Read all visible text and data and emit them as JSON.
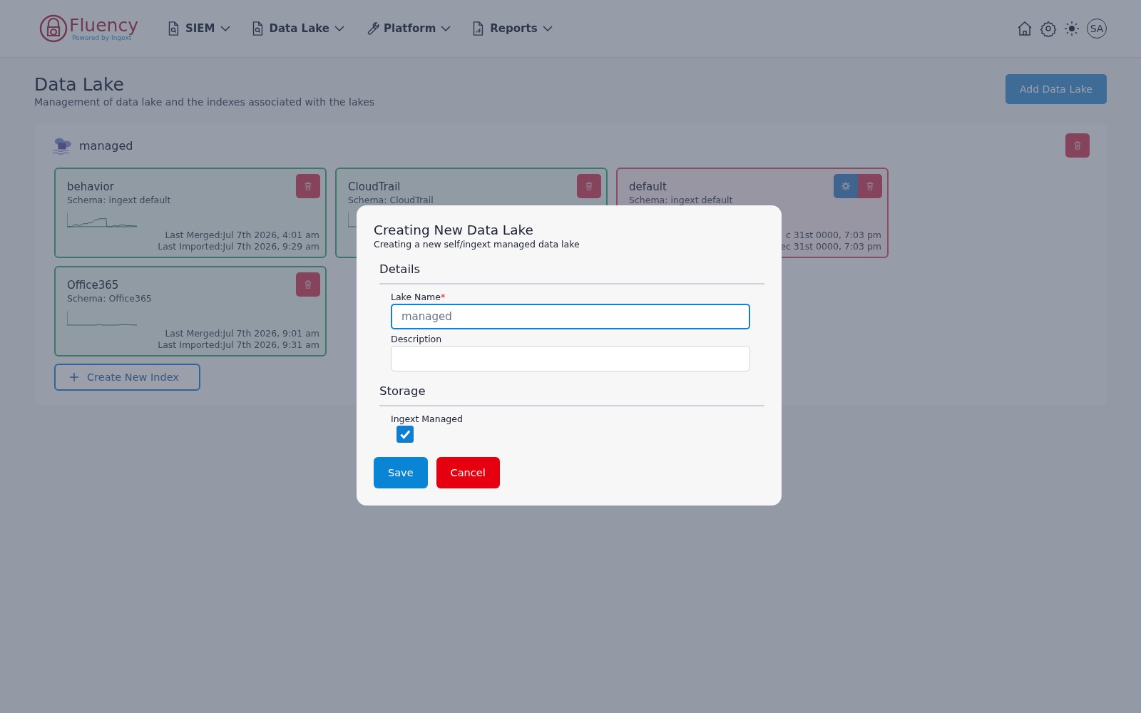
{
  "brand": {
    "name": "Fluency",
    "tagline": "Powered by Ingext"
  },
  "nav": [
    {
      "label": "SIEM"
    },
    {
      "label": "Data Lake"
    },
    {
      "label": "Platform"
    },
    {
      "label": "Reports"
    }
  ],
  "user": {
    "initials": "SA"
  },
  "page": {
    "title": "Data Lake",
    "subtitle": "Management of data lake and the indexes associated with the lakes",
    "add_button": "Add Data Lake"
  },
  "lake": {
    "name": "managed",
    "indexes": [
      {
        "name": "behavior",
        "schema": "Schema: ingext default",
        "kind": "healthy",
        "settings": false,
        "merged": "Last Merged:Jul 7th 2026, 4:01 am",
        "imported": "Last Imported:Jul 7th 2026, 9:29 am"
      },
      {
        "name": "CloudTrail",
        "schema": "Schema: CloudTrail",
        "kind": "healthy",
        "settings": false
      },
      {
        "name": "default",
        "schema": "Schema: ingext default",
        "kind": "failing",
        "settings": true,
        "merged": "c 31st 0000, 7:03 pm",
        "imported": "ec 31st 0000, 7:03 pm"
      },
      {
        "name": "Office365",
        "schema": "Schema: Office365",
        "kind": "healthy",
        "settings": false,
        "merged": "Last Merged:Jul 7th 2026, 9:01 am",
        "imported": "Last Imported:Jul 7th 2026, 9:31 am"
      }
    ],
    "create_button": "Create New Index"
  },
  "dialog": {
    "title": "Creating New Data Lake",
    "subtitle": "Creating a new self/ingext managed data lake",
    "sections": [
      {
        "title": "Details",
        "fields": [
          {
            "kind": "text",
            "label": "Lake Name",
            "required_mark": "*",
            "placeholder": "managed",
            "focused": true
          },
          {
            "kind": "text",
            "label": "Description",
            "focused": false
          }
        ]
      },
      {
        "title": "Storage",
        "fields": [
          {
            "kind": "checkbox",
            "label": "Ingext Managed",
            "checked": true
          }
        ]
      }
    ],
    "buttons": [
      {
        "label": "Save",
        "kind": "primary"
      },
      {
        "label": "Cancel",
        "kind": "danger"
      }
    ]
  }
}
